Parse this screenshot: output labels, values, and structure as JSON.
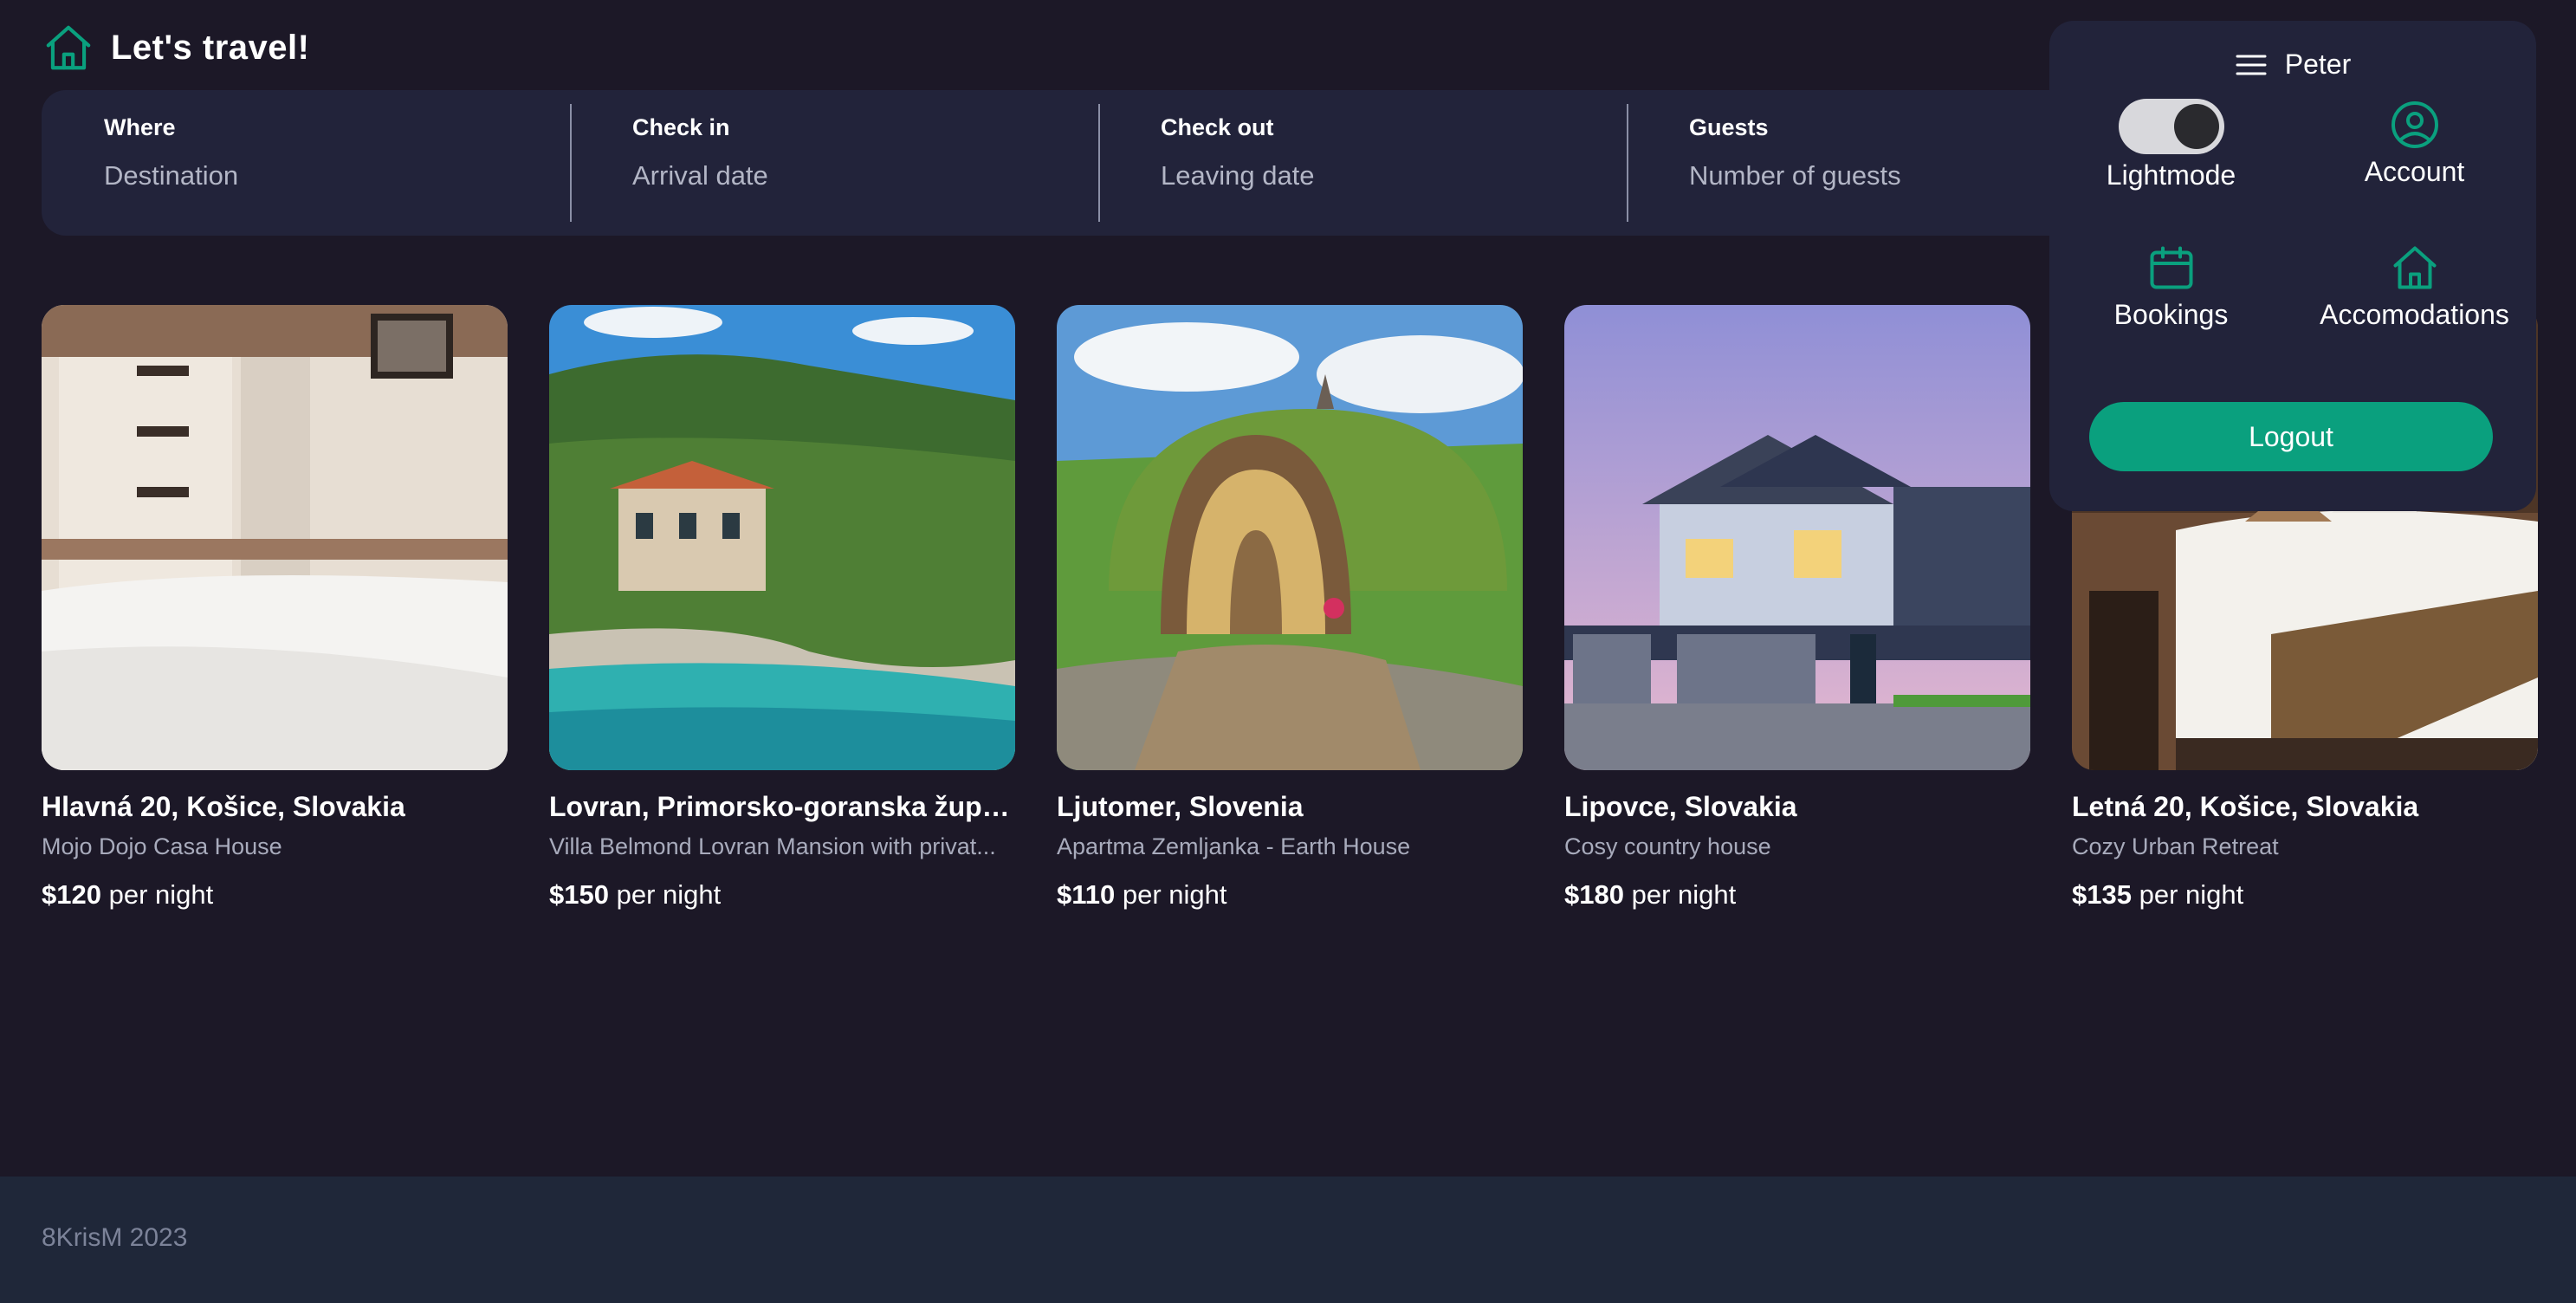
{
  "header": {
    "title": "Let's travel!",
    "icon": "home-icon"
  },
  "search": {
    "where_label": "Where",
    "where_placeholder": "Destination",
    "checkin_label": "Check in",
    "checkin_placeholder": "Arrival date",
    "checkout_label": "Check out",
    "checkout_placeholder": "Leaving date",
    "guests_label": "Guests",
    "guests_placeholder": "Number of guests"
  },
  "listings": [
    {
      "location": "Hlavná 20, Košice, Slovakia",
      "name": "Mojo Dojo Casa House",
      "price": "$120",
      "unit": "per night"
    },
    {
      "location": "Lovran, Primorsko-goranska župan...",
      "name": "Villa Belmond Lovran Mansion with privat...",
      "price": "$150",
      "unit": "per night"
    },
    {
      "location": "Ljutomer, Slovenia",
      "name": "Apartma Zemljanka - Earth House",
      "price": "$110",
      "unit": "per night"
    },
    {
      "location": "Lipovce, Slovakia",
      "name": "Cosy country house",
      "price": "$180",
      "unit": "per night"
    },
    {
      "location": "Letná 20, Košice, Slovakia",
      "name": "Cozy Urban Retreat",
      "price": "$135",
      "unit": "per night"
    }
  ],
  "menu": {
    "user_name": "Peter",
    "menu_icon": "hamburger-icon",
    "items": [
      {
        "label": "Lightmode",
        "icon": "toggle-switch"
      },
      {
        "label": "Account",
        "icon": "user-circle-icon"
      },
      {
        "label": "Bookings",
        "icon": "calendar-icon"
      },
      {
        "label": "Accomodations",
        "icon": "home-icon"
      }
    ],
    "lightmode_on": true,
    "logout_label": "Logout"
  },
  "footer": {
    "text": "8KrisM 2023"
  },
  "colors": {
    "accent": "#0aa07e",
    "background": "#1c1827",
    "panel": "#22233a",
    "footer": "#1f2739"
  }
}
